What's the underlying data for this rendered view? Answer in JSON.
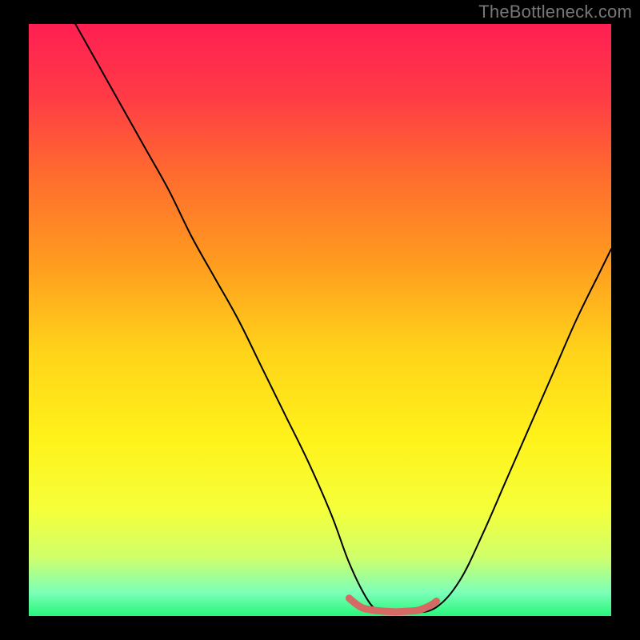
{
  "watermark": "TheBottleneck.com",
  "chart_data": {
    "type": "line",
    "title": "",
    "xlabel": "",
    "ylabel": "",
    "xlim": [
      0,
      100
    ],
    "ylim": [
      0,
      100
    ],
    "grid": false,
    "legend": false,
    "series": [
      {
        "name": "main-curve",
        "color": "#000000",
        "x": [
          8,
          12,
          16,
          20,
          24,
          28,
          32,
          36,
          40,
          44,
          48,
          52,
          55,
          58,
          60,
          63,
          66,
          70,
          74,
          78,
          82,
          86,
          90,
          94,
          98,
          100
        ],
        "y": [
          100,
          93,
          86,
          79,
          72,
          64,
          57,
          50,
          42,
          34,
          26,
          17,
          9,
          3,
          1,
          0.5,
          0.5,
          1.5,
          6,
          14,
          23,
          32,
          41,
          50,
          58,
          62
        ]
      },
      {
        "name": "bottom-highlight",
        "color": "#d46a63",
        "x": [
          55,
          57,
          59,
          61,
          63,
          65,
          67,
          69,
          70
        ],
        "y": [
          3,
          1.5,
          1,
          0.8,
          0.7,
          0.8,
          1,
          1.8,
          2.5
        ]
      }
    ],
    "background_gradient_stops": [
      {
        "offset": 0.0,
        "color": "#ff1f52"
      },
      {
        "offset": 0.12,
        "color": "#ff3a46"
      },
      {
        "offset": 0.25,
        "color": "#ff6a2f"
      },
      {
        "offset": 0.4,
        "color": "#ff9a1f"
      },
      {
        "offset": 0.55,
        "color": "#ffd21a"
      },
      {
        "offset": 0.7,
        "color": "#fff21a"
      },
      {
        "offset": 0.82,
        "color": "#f5ff3a"
      },
      {
        "offset": 0.9,
        "color": "#d0ff6a"
      },
      {
        "offset": 0.96,
        "color": "#7cffb8"
      },
      {
        "offset": 1.0,
        "color": "#28f57a"
      }
    ]
  }
}
